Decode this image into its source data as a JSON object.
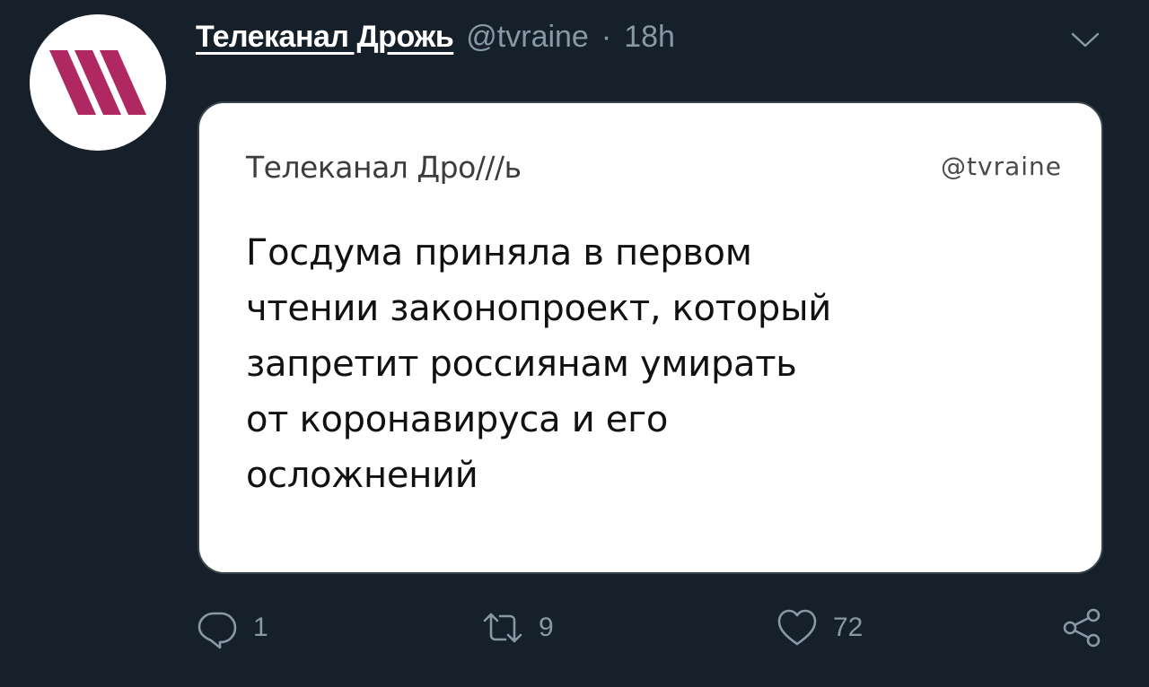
{
  "tweet": {
    "display_name": "Телеканал Дрожь",
    "handle": "@tvraine",
    "separator": "·",
    "time": "18h"
  },
  "card": {
    "brand": "Телеканал Дро///ь",
    "handle": "@tvraine",
    "lines": [
      "Госдума приняла в первом",
      "чтении законопроект, который",
      "запретит россиянам умирать",
      "от коронавируса и его",
      "осложнений"
    ]
  },
  "actions": {
    "reply_count": "1",
    "retweet_count": "9",
    "like_count": "72"
  },
  "icons": {
    "avatar": "tv-rain-logo-icon",
    "caret": "chevron-down-icon",
    "reply": "reply-icon",
    "retweet": "retweet-icon",
    "like": "heart-icon",
    "share": "share-icon"
  },
  "colors": {
    "background": "#15202b",
    "muted": "#8899a6",
    "logo_pink": "#c4266b"
  }
}
